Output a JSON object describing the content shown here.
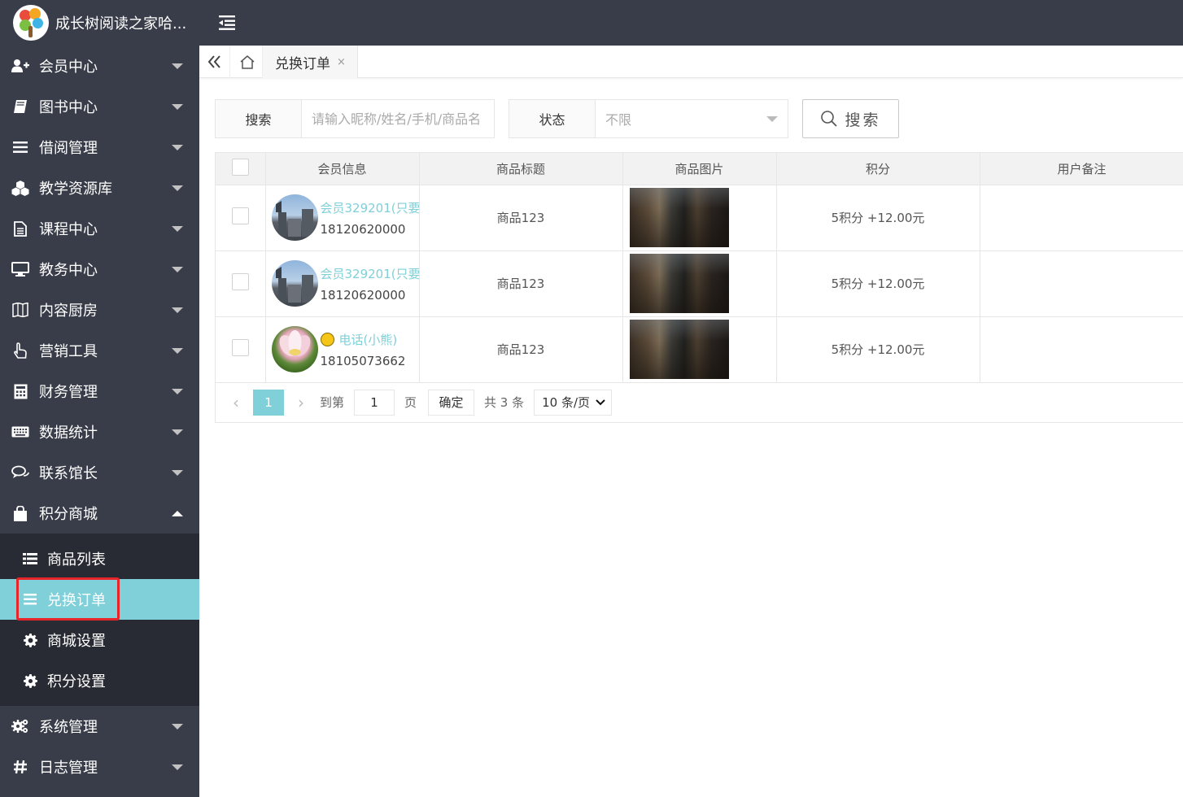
{
  "app": {
    "title": "成长树阅读之家哈..."
  },
  "sidebar": {
    "items": [
      {
        "label": "会员中心",
        "icon": "user-plus-icon"
      },
      {
        "label": "图书中心",
        "icon": "book-icon"
      },
      {
        "label": "借阅管理",
        "icon": "list-icon"
      },
      {
        "label": "教学资源库",
        "icon": "cubes-icon"
      },
      {
        "label": "课程中心",
        "icon": "document-icon"
      },
      {
        "label": "教务中心",
        "icon": "monitor-icon"
      },
      {
        "label": "内容厨房",
        "icon": "map-book-icon"
      },
      {
        "label": "营销工具",
        "icon": "hand-pointer-icon"
      },
      {
        "label": "财务管理",
        "icon": "calculator-icon"
      },
      {
        "label": "数据统计",
        "icon": "keyboard-icon"
      },
      {
        "label": "联系馆长",
        "icon": "chat-icon"
      },
      {
        "label": "积分商城",
        "icon": "shopping-bag-icon"
      }
    ],
    "sub_items": [
      {
        "label": "商品列表",
        "icon": "th-list-icon"
      },
      {
        "label": "兑换订单",
        "icon": "bars-icon"
      },
      {
        "label": "商城设置",
        "icon": "gear-icon"
      },
      {
        "label": "积分设置",
        "icon": "gear-icon"
      }
    ],
    "bottom_items": [
      {
        "label": "系统管理",
        "icon": "gears-icon"
      },
      {
        "label": "日志管理",
        "icon": "hashtag-icon"
      }
    ]
  },
  "tabs": [
    {
      "label": "兑换订单",
      "close": "×"
    }
  ],
  "search": {
    "keyword_label": "搜索",
    "keyword_placeholder": "请输入昵称/姓名/手机/商品名",
    "status_label": "状态",
    "status_value": "不限",
    "button_label": "搜索"
  },
  "table": {
    "headers": [
      "会员信息",
      "商品标题",
      "商品图片",
      "积分",
      "用户备注"
    ],
    "rows": [
      {
        "member_name": "会员329201(只要想",
        "phone": "18120620000",
        "title": "商品123",
        "points": "5积分 +12.00元",
        "remark": "",
        "avatar": "castle"
      },
      {
        "member_name": "会员329201(只要想",
        "phone": "18120620000",
        "title": "商品123",
        "points": "5积分 +12.00元",
        "remark": "",
        "avatar": "castle"
      },
      {
        "member_name": "电话(小熊)",
        "phone": "18105073662",
        "title": "商品123",
        "points": "5积分 +12.00元",
        "remark": "",
        "avatar": "lotus",
        "emoji": true
      }
    ]
  },
  "pager": {
    "prev": "‹",
    "current": "1",
    "next": "›",
    "goto_label": "到第",
    "goto_value": "1",
    "page_unit": "页",
    "confirm": "确定",
    "total": "共 3 条",
    "page_size": "10 条/页"
  },
  "colors": {
    "sidebar_bg": "#393D49",
    "accent": "#7FD0D8",
    "highlight": "#E8262A"
  }
}
